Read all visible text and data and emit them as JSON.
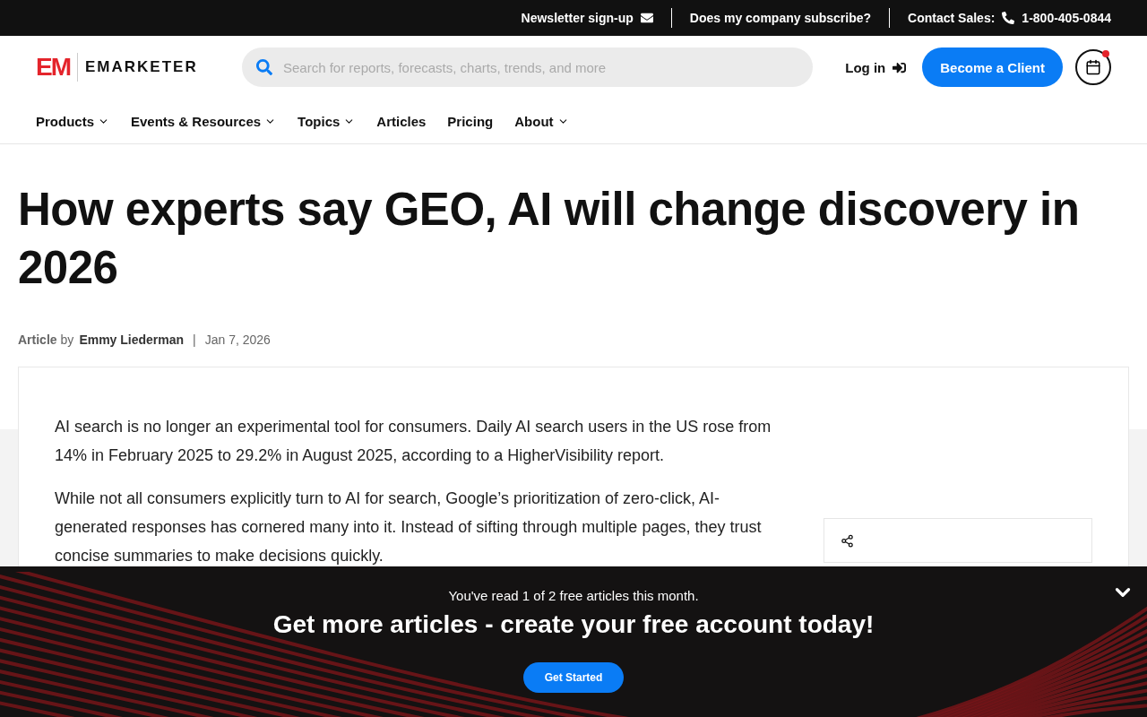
{
  "top_bar": {
    "newsletter": "Newsletter sign-up",
    "subscribe": "Does my company subscribe?",
    "contact_label": "Contact Sales:",
    "phone": "1-800-405-0844"
  },
  "header": {
    "logo_mark": "EM",
    "logo_text": "EMARKETER",
    "search": {
      "placeholder": "Search for reports, forecasts, charts, trends, and more"
    },
    "login": "Log in",
    "cta": "Become a Client"
  },
  "nav": [
    {
      "label": "Products",
      "dropdown": true
    },
    {
      "label": "Events & Resources",
      "dropdown": true
    },
    {
      "label": "Topics",
      "dropdown": true
    },
    {
      "label": "Articles",
      "dropdown": false
    },
    {
      "label": "Pricing",
      "dropdown": false
    },
    {
      "label": "About",
      "dropdown": true
    }
  ],
  "article": {
    "title": "How experts say GEO, AI will change discovery in 2026",
    "byline": {
      "type": "Article",
      "by": "by",
      "author": "Emmy Liederman",
      "separator": "|",
      "date": "Jan 7, 2026"
    },
    "paragraphs": [
      "AI search is no longer an experimental tool for consumers. Daily AI search users in the US rose from 14% in February 2025 to 29.2% in August 2025, according to a HigherVisibility report.",
      "While not all consumers explicitly turn to AI for search, Google’s prioritization of zero-click, AI-generated responses has cornered many into it. Instead of sifting through multiple pages, they trust concise summaries to make decisions quickly."
    ]
  },
  "paywall_banner": {
    "notice": "You've read 1 of 2 free articles this month.",
    "headline": "Get more articles - create your free account today!",
    "button": "Get Started"
  }
}
